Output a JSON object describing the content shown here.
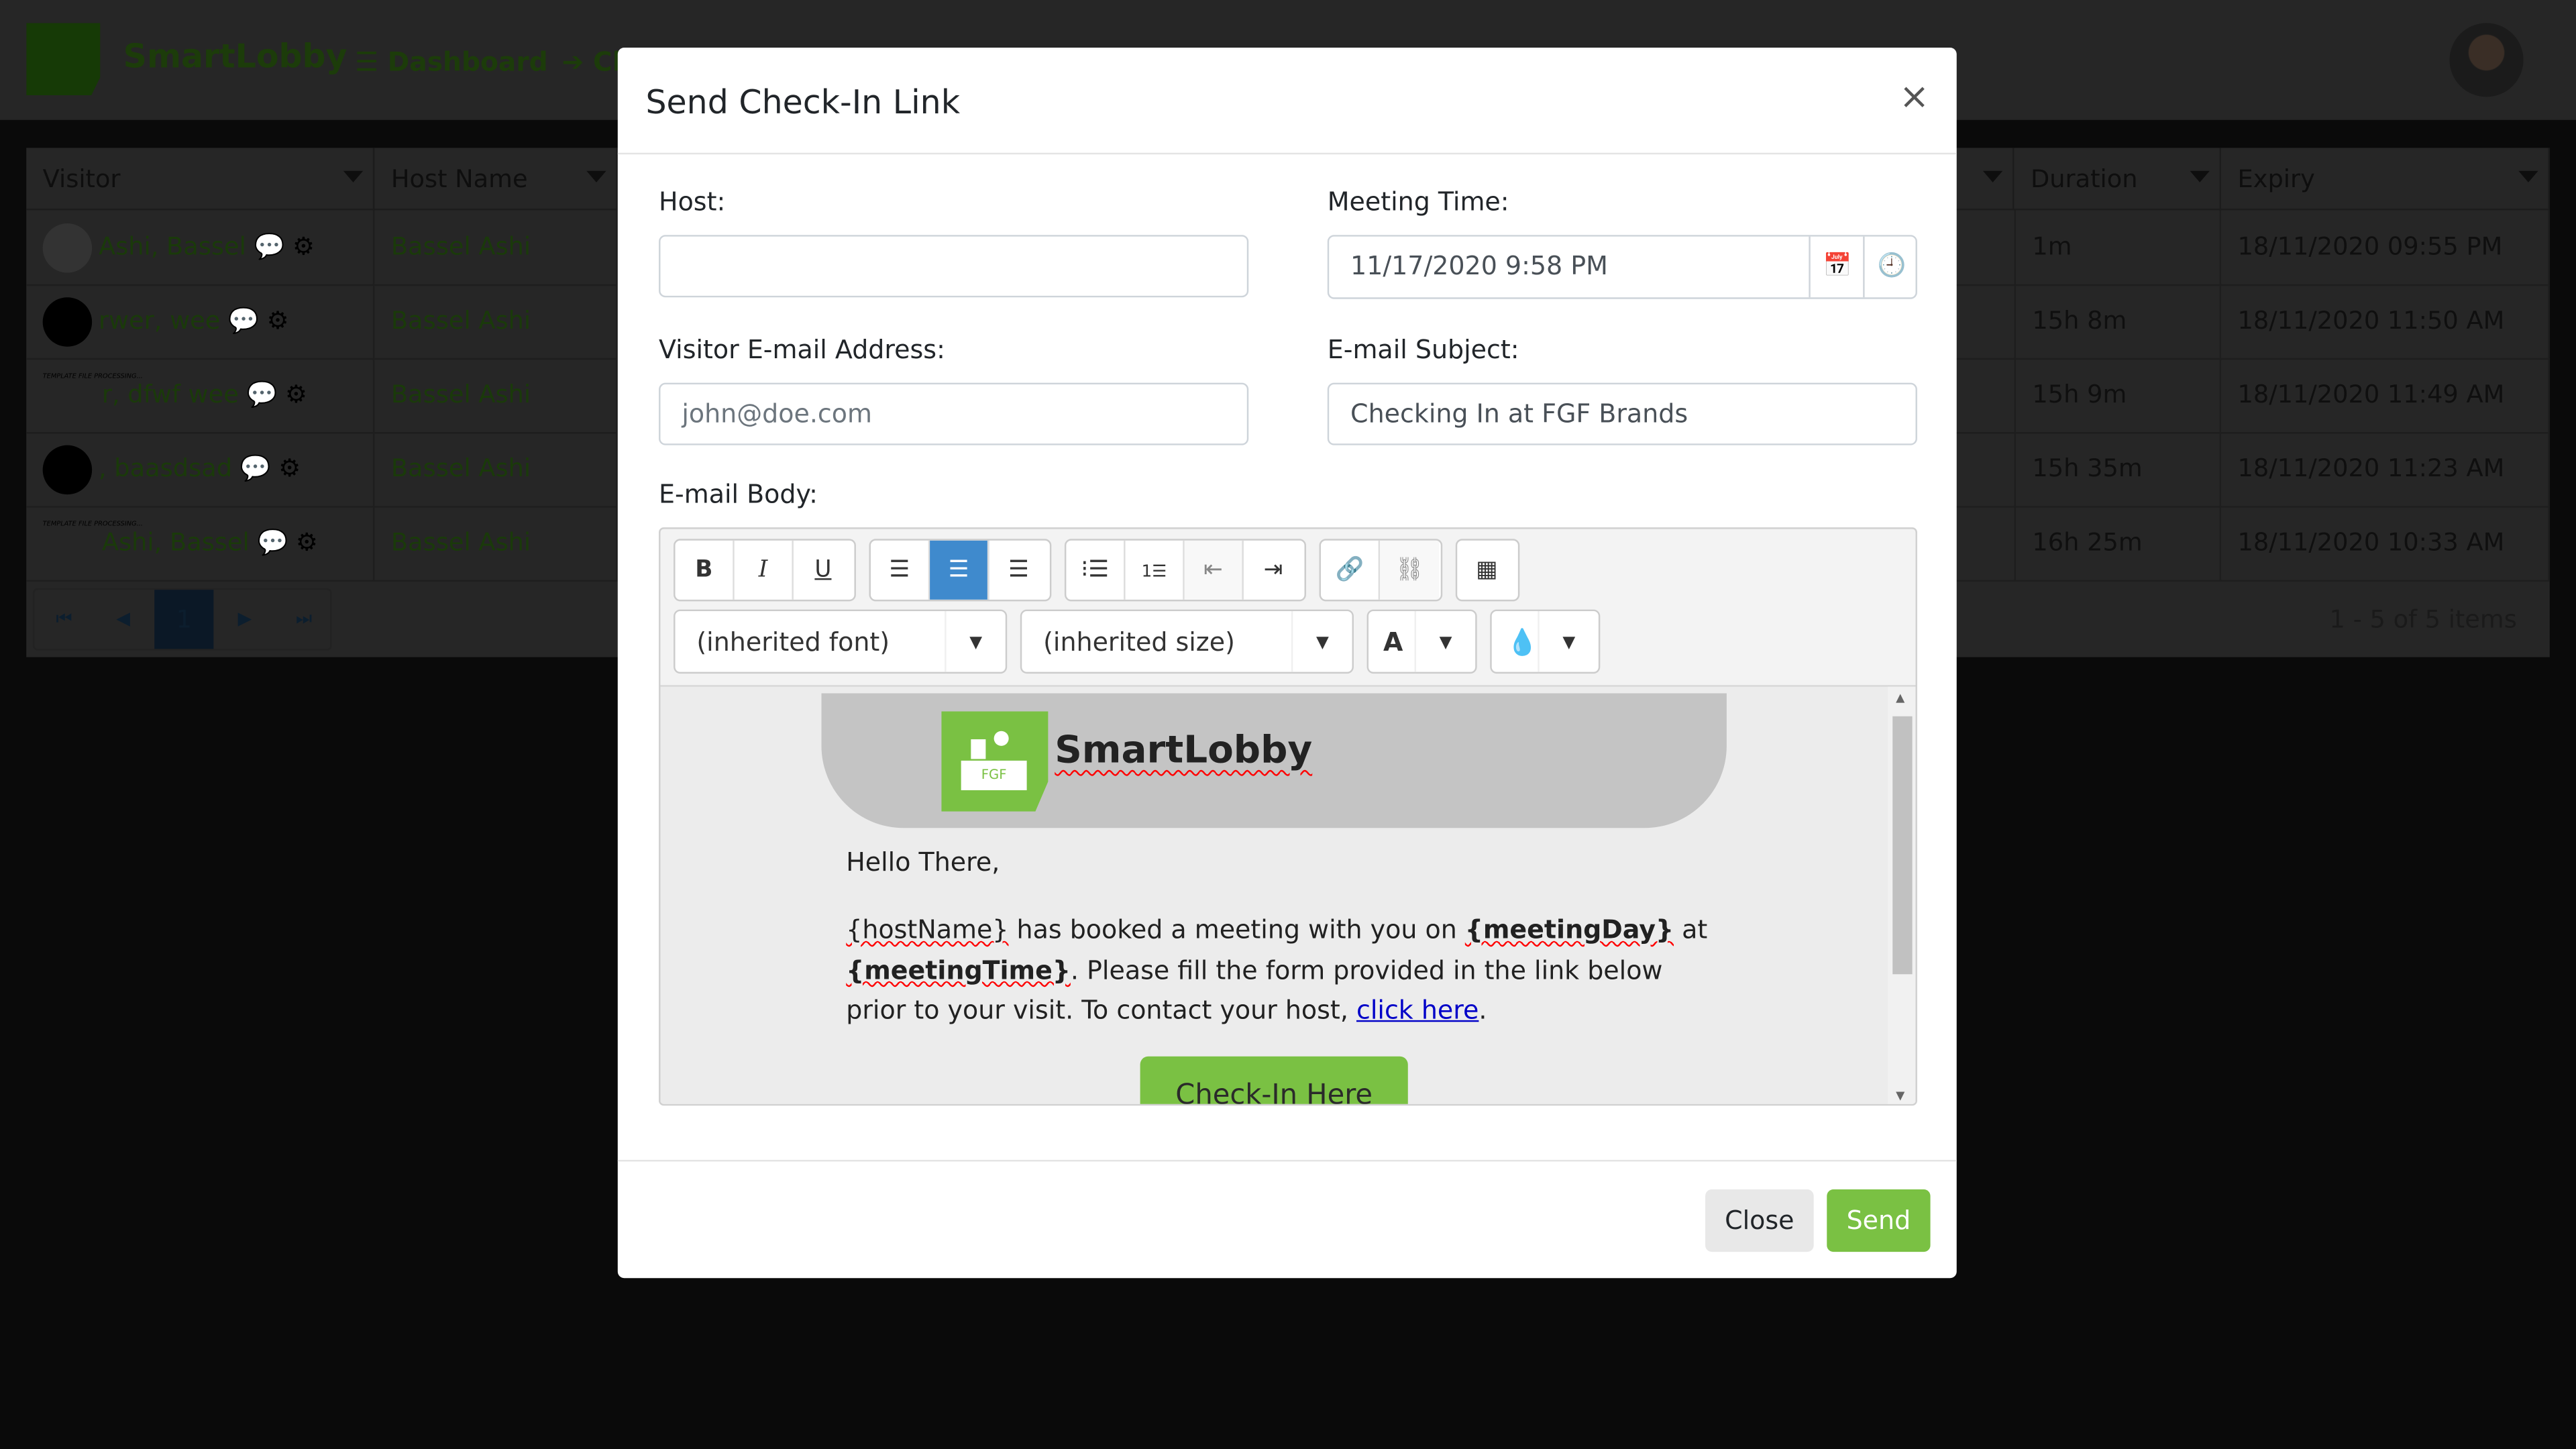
{
  "app": {
    "brand": "SmartLobby",
    "nav": [
      {
        "label": "Dashboard",
        "icon": "bars-icon"
      },
      {
        "label": "Ch",
        "icon": "arrow-right-icon"
      }
    ]
  },
  "grid": {
    "columns": [
      "Visitor",
      "Host Name",
      "Duration",
      "Expiry"
    ],
    "rows": [
      {
        "visitor": "Ashi, Bassel",
        "host": "Bassel Ashi",
        "duration": "1m",
        "expiry": "18/11/2020 09:55 PM"
      },
      {
        "visitor": "rwer, wee",
        "host": "Bassel Ashi",
        "duration": "15h 8m",
        "expiry": "18/11/2020 11:50 AM"
      },
      {
        "visitor": "r, dfwf wee",
        "host": "Bassel Ashi",
        "duration": "15h 9m",
        "expiry": "18/11/2020 11:49 AM"
      },
      {
        "visitor": ", baasdsad",
        "host": "Bassel Ashi",
        "duration": "15h 35m",
        "expiry": "18/11/2020 11:23 AM"
      },
      {
        "visitor": "Ashi, Bassel",
        "host": "Bassel Ashi",
        "duration": "16h 25m",
        "expiry": "18/11/2020 10:33 AM"
      }
    ],
    "avatar_placeholder": "TEMPLATE FILE PROCESSING...",
    "pager": {
      "page": "1",
      "summary": "1 - 5 of 5 items"
    }
  },
  "modal": {
    "title": "Send Check-In Link",
    "close": "×",
    "host_label": "Host:",
    "host_value": "",
    "meeting_time_label": "Meeting Time:",
    "meeting_time_value": "11/17/2020 9:58 PM",
    "visitor_email_label": "Visitor E-mail Address:",
    "visitor_email_placeholder": "john@doe.com",
    "subject_label": "E-mail Subject:",
    "subject_value": "Checking In at FGF Brands",
    "body_label": "E-mail Body:",
    "font_select": "(inherited font)",
    "size_select": "(inherited size)",
    "email": {
      "brand": "SmartLobby",
      "logo_text": "FGF",
      "greeting": "Hello There,",
      "host_placeholder": "{hostName}",
      "text1": " has booked a meeting with you on ",
      "meeting_day": "{meetingDay}",
      "text2": " at ",
      "meeting_time": "{meetingTime}",
      "text3": ". Please fill the form provided in the link below prior to your visit. To contact your host, ",
      "link": "click here",
      "text4": ".",
      "button": "Check-In Here"
    },
    "close_button": "Close",
    "send_button": "Send"
  },
  "colors": {
    "accent": "#7ac143",
    "active_tool": "#3f8acd"
  }
}
